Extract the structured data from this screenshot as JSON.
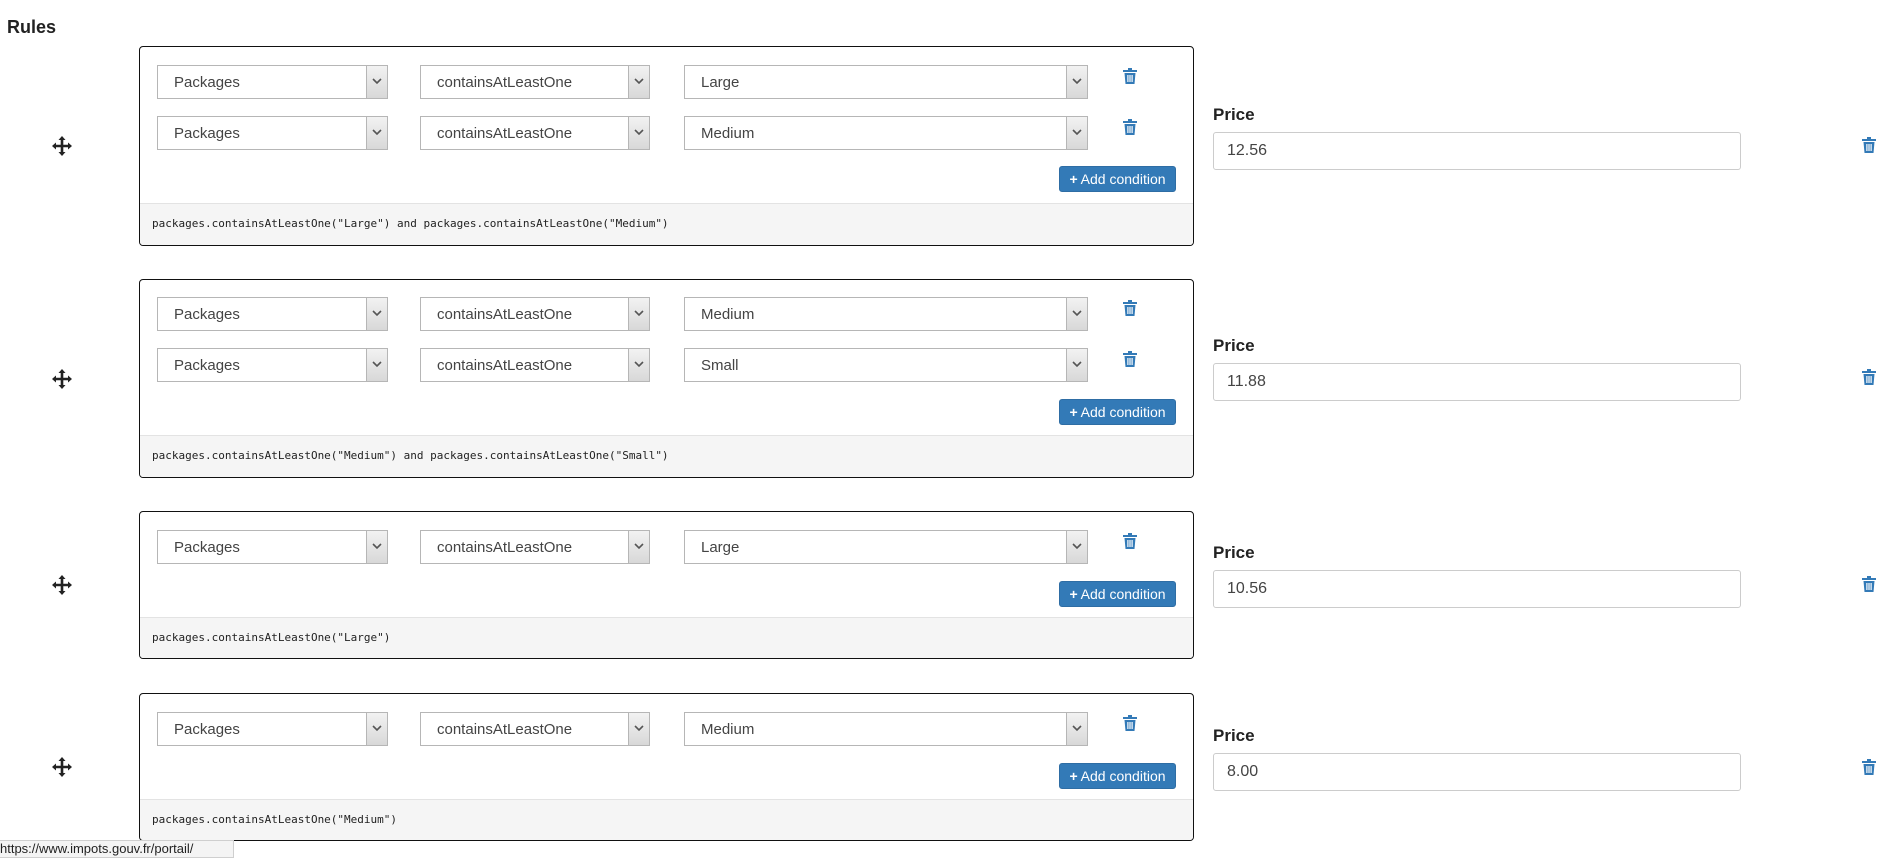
{
  "page": {
    "title": "Rules"
  },
  "labels": {
    "price": "Price",
    "add_condition": "Add condition"
  },
  "icons": {
    "drag": "move-arrows-icon",
    "delete": "trash-icon",
    "add": "plus-icon",
    "dropdown": "chevron-down-icon"
  },
  "colors": {
    "primary": "#337ab7",
    "trash": "#337ab7"
  },
  "rules": [
    {
      "conditions": [
        {
          "field": "Packages",
          "operator": "containsAtLeastOne",
          "value": "Large"
        },
        {
          "field": "Packages",
          "operator": "containsAtLeastOne",
          "value": "Medium"
        }
      ],
      "expression": "packages.containsAtLeastOne(\"Large\") and packages.containsAtLeastOne(\"Medium\")",
      "price": "12.56"
    },
    {
      "conditions": [
        {
          "field": "Packages",
          "operator": "containsAtLeastOne",
          "value": "Medium"
        },
        {
          "field": "Packages",
          "operator": "containsAtLeastOne",
          "value": "Small"
        }
      ],
      "expression": "packages.containsAtLeastOne(\"Medium\") and packages.containsAtLeastOne(\"Small\")",
      "price": "11.88"
    },
    {
      "conditions": [
        {
          "field": "Packages",
          "operator": "containsAtLeastOne",
          "value": "Large"
        }
      ],
      "expression": "packages.containsAtLeastOne(\"Large\")",
      "price": "10.56"
    },
    {
      "conditions": [
        {
          "field": "Packages",
          "operator": "containsAtLeastOne",
          "value": "Medium"
        }
      ],
      "expression": "packages.containsAtLeastOne(\"Medium\")",
      "price": "8.00"
    }
  ],
  "status_bar": {
    "url": "https://www.impots.gouv.fr/portail/"
  }
}
